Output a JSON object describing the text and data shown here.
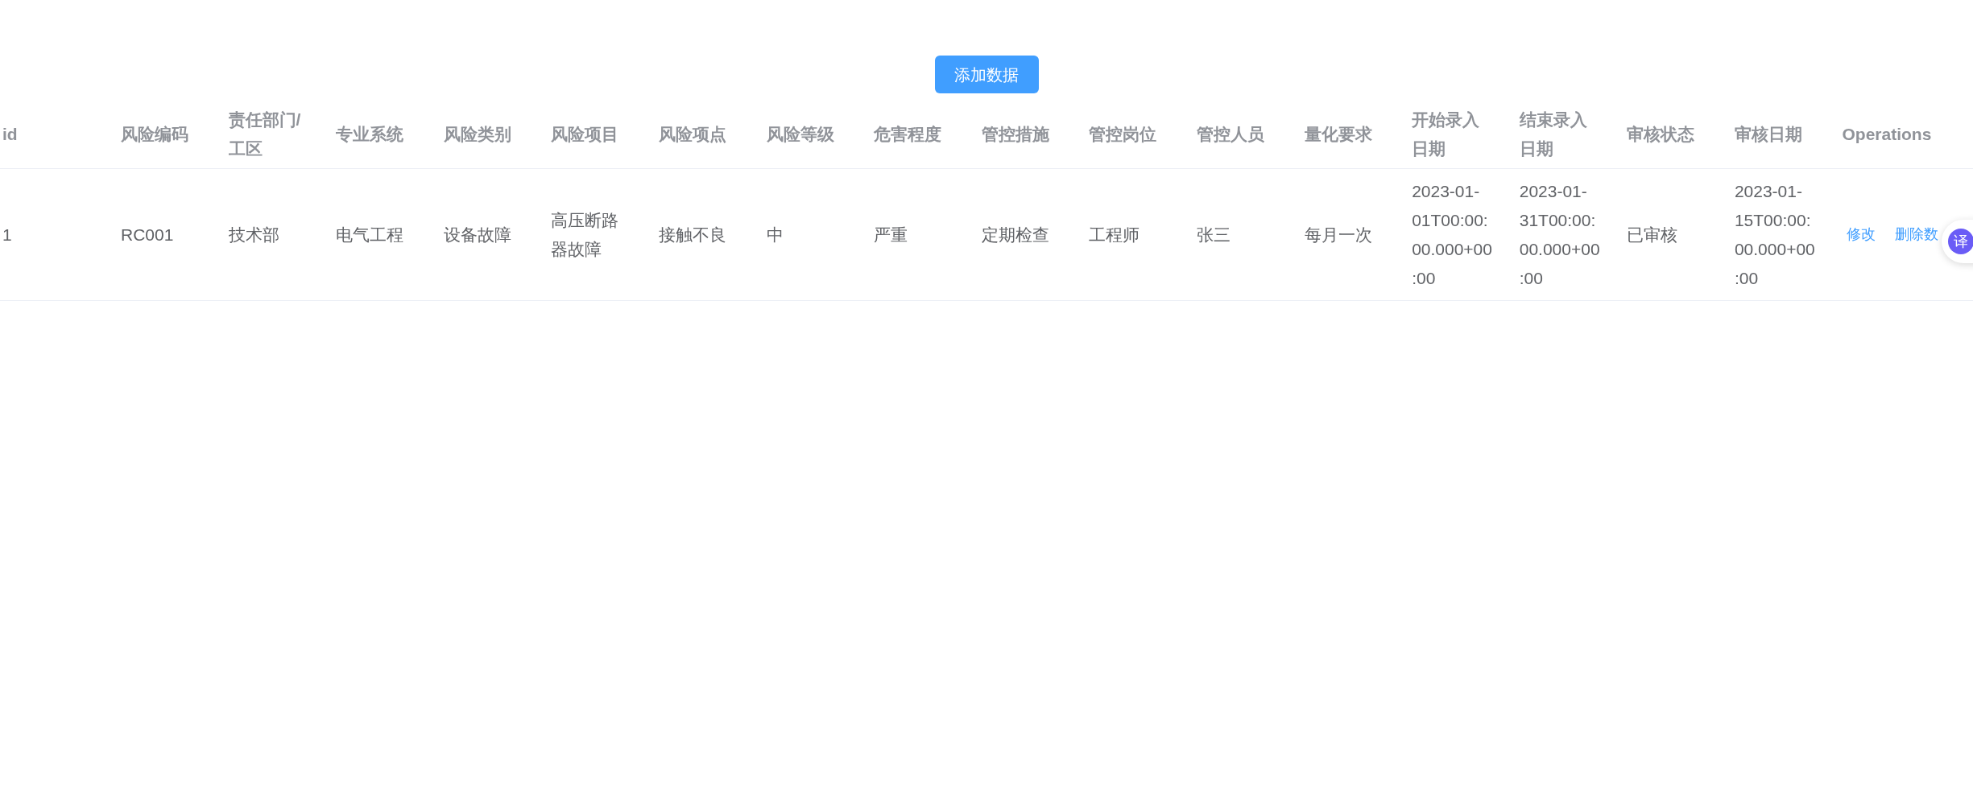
{
  "toolbar": {
    "add_button": "添加数据"
  },
  "table": {
    "columns": [
      "id",
      "风险编码",
      "责任部门/工区",
      "专业系统",
      "风险类别",
      "风险项目",
      "风险项点",
      "风险等级",
      "危害程度",
      "管控措施",
      "管控岗位",
      "管控人员",
      "量化要求",
      "开始录入日期",
      "结束录入日期",
      "审核状态",
      "审核日期",
      "Operations"
    ],
    "rows": [
      {
        "cells": [
          "1",
          "RC001",
          "技术部",
          "电气工程",
          "设备故障",
          "高压断路器故障",
          "接触不良",
          "中",
          "严重",
          "定期检查",
          "工程师",
          "张三",
          "每月一次",
          "2023-01-01T00:00:00.000+00:00",
          "2023-01-31T00:00:00.000+00:00",
          "已审核",
          "2023-01-15T00:00:00.000+00:00"
        ],
        "actions": [
          "修改",
          "删除数"
        ]
      }
    ]
  },
  "floating_widget": {
    "label": "译"
  }
}
